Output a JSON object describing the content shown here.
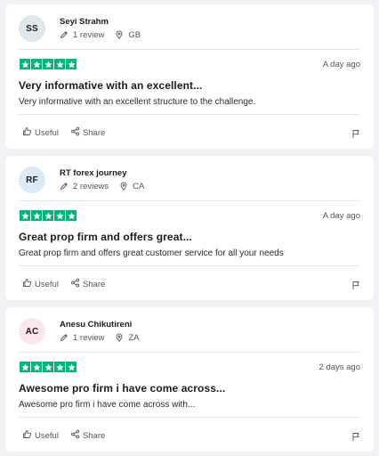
{
  "reviews": [
    {
      "initials": "SS",
      "avatar_color": "#dce8ec",
      "name": "Seyi Strahm",
      "review_count": "1 review",
      "country": "GB",
      "stars": 5,
      "date": "A day ago",
      "title": "Very informative with an excellent...",
      "body": "Very informative with an excellent structure to the challenge.",
      "useful_label": "Useful",
      "share_label": "Share"
    },
    {
      "initials": "RF",
      "avatar_color": "#dceaf7",
      "name": "RT forex journey",
      "review_count": "2 reviews",
      "country": "CA",
      "stars": 5,
      "date": "A day ago",
      "title": "Great prop firm and offers great...",
      "body": "Great prop firm and offers great customer service for all your needs",
      "useful_label": "Useful",
      "share_label": "Share"
    },
    {
      "initials": "AC",
      "avatar_color": "#fbe6ee",
      "name": "Anesu Chikutireni",
      "review_count": "1 review",
      "country": "ZA",
      "stars": 5,
      "date": "2 days ago",
      "title": "Awesome pro firm i have come across...",
      "body": "Awesome pro firm i have come across with...",
      "useful_label": "Useful",
      "share_label": "Share"
    }
  ],
  "colors": {
    "star_green": "#00b67a",
    "card_bg": "#ffffff",
    "page_bg": "#f1f1f6"
  },
  "icons": [
    "pencil-icon",
    "location-pin-icon",
    "star-icon",
    "thumbs-up-icon",
    "share-icon",
    "flag-icon"
  ]
}
